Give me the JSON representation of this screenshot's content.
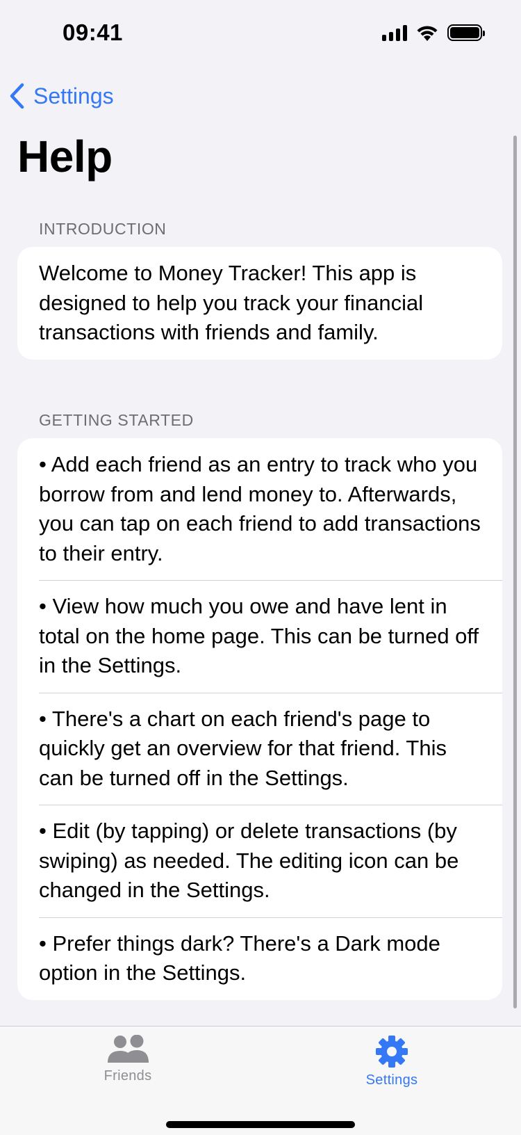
{
  "status_bar": {
    "time": "09:41",
    "icons": [
      "cellular-signal-icon",
      "wifi-icon",
      "battery-icon"
    ]
  },
  "nav": {
    "back_label": "Settings",
    "back_icon": "chevron-left-icon",
    "title": "Help"
  },
  "sections": [
    {
      "header": "INTRODUCTION",
      "rows": [
        "Welcome to Money Tracker! This app is designed to help you track your financial transactions with friends and family."
      ]
    },
    {
      "header": "GETTING STARTED",
      "rows": [
        "• Add each friend as an entry to track who you borrow from and lend money to. Afterwards, you can tap on each friend to add transactions to their entry.",
        "• View how much you owe and have lent in total on the home page. This can be turned off in the Settings.",
        "• There's a chart on each friend's page to quickly get an overview for that friend. This can be turned off in the Settings.",
        "• Edit (by tapping) or delete transactions (by swiping) as needed. The editing icon can be changed in the Settings.",
        "• Prefer things dark? There's a Dark mode option in the Settings."
      ]
    }
  ],
  "tab_bar": {
    "tabs": [
      {
        "label": "Friends",
        "icon": "people-icon",
        "selected": false
      },
      {
        "label": "Settings",
        "icon": "gear-icon",
        "selected": true
      }
    ]
  },
  "colors": {
    "accent": "#3478f6",
    "background": "#f2f2f7",
    "card": "#ffffff",
    "secondary_text": "#6d6d72",
    "inactive_tab": "#8e8e93"
  }
}
